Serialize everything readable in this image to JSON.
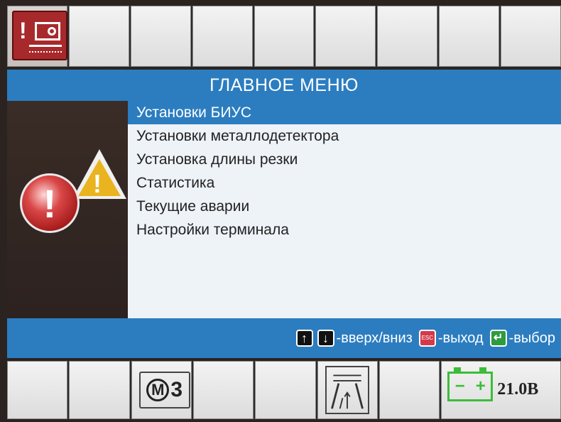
{
  "title": "ГЛАВНОЕ МЕНЮ",
  "menu": {
    "items": [
      {
        "label": "Установки БИУС",
        "selected": true
      },
      {
        "label": "Установки металлодетектора",
        "selected": false
      },
      {
        "label": "Установка длины резки",
        "selected": false
      },
      {
        "label": "Статистика",
        "selected": false
      },
      {
        "label": "Текущие аварии",
        "selected": false
      },
      {
        "label": "Настройки терминала",
        "selected": false
      }
    ]
  },
  "help": {
    "updown": "-вверх/вниз",
    "exit": "-выход",
    "select": "-выбор",
    "esc_key": "ESC"
  },
  "icons": {
    "top_left": "alarm-machine-icon",
    "warning_circle": "exclamation-circle-icon",
    "warning_triangle": "warning-triangle-icon",
    "bottom_m3": "m3-mode-icon",
    "bottom_road": "road-direction-icon",
    "bottom_battery": "battery-icon"
  },
  "status": {
    "m3_label": "3",
    "m_label": "M",
    "voltage": "21.0В"
  },
  "colors": {
    "accent": "#2c7dc0",
    "alarm": "#a8292b",
    "battery": "#3cbd3a"
  }
}
